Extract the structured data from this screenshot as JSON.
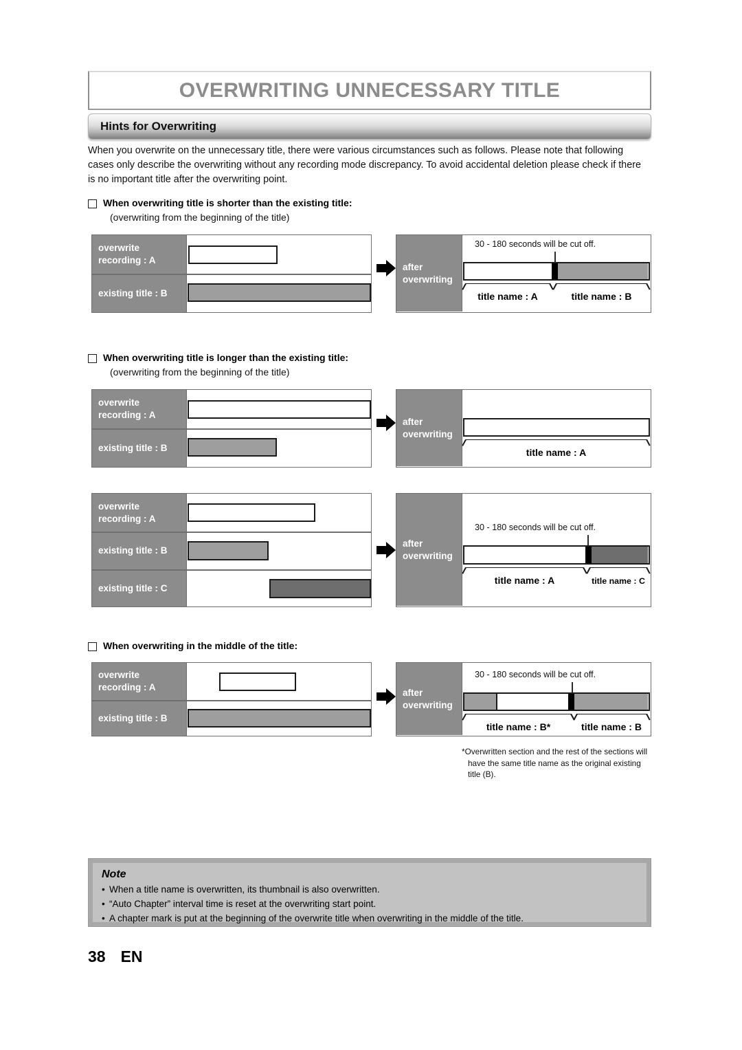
{
  "header": {
    "title": "OVERWRITING UNNECESSARY TITLE",
    "section": "Hints for Overwriting"
  },
  "intro": "When you overwrite on the unnecessary title, there were various circumstances such as follows.  Please note that following cases only describe the overwriting without any recording mode discrepancy.  To avoid accidental deletion please check if there is no important title after the overwriting point.",
  "labels": {
    "overwrite_line1": "overwrite",
    "overwrite_line2": "recording : A",
    "existing_b": "existing title : B",
    "existing_c": "existing title : C",
    "after_line1": "after",
    "after_line2": "overwriting",
    "cut_note": "30 - 180 seconds will be cut off.",
    "title_name_a": "title name : A",
    "title_name_b": "title name : B",
    "title_name_c": "title name : C",
    "title_name_b_star": "title name : B*"
  },
  "cases": [
    {
      "heading": "When overwriting title is shorter than the existing title:",
      "sub": "(overwriting from the beginning of the title)"
    },
    {
      "heading": "When overwriting title is longer than the existing title:",
      "sub": "(overwriting from the beginning of the title)"
    },
    {
      "heading": "When overwriting in the middle of the title:",
      "sub": ""
    }
  ],
  "footnote": {
    "line1": "*Overwritten section and the rest of the sections will",
    "line2": "have the same title name as the original existing",
    "line3": "title (B)."
  },
  "note": {
    "title": "Note",
    "bullet_mark": "•",
    "items": [
      "When a title name is overwritten, its thumbnail is also overwritten.",
      "“Auto Chapter” interval time is reset at the overwriting start point.",
      "A chapter mark is put at the beginning of the overwrite title when overwriting in the middle of the title."
    ]
  },
  "footer": {
    "page": "38",
    "lang": "EN"
  },
  "colors": {
    "label_gray": "#8c8c8c",
    "bar_gray": "#9e9e9e",
    "bar_dark": "#6e6e6e",
    "title_gray": "#8c8c8c",
    "note_bg": "#c2c2c2"
  }
}
